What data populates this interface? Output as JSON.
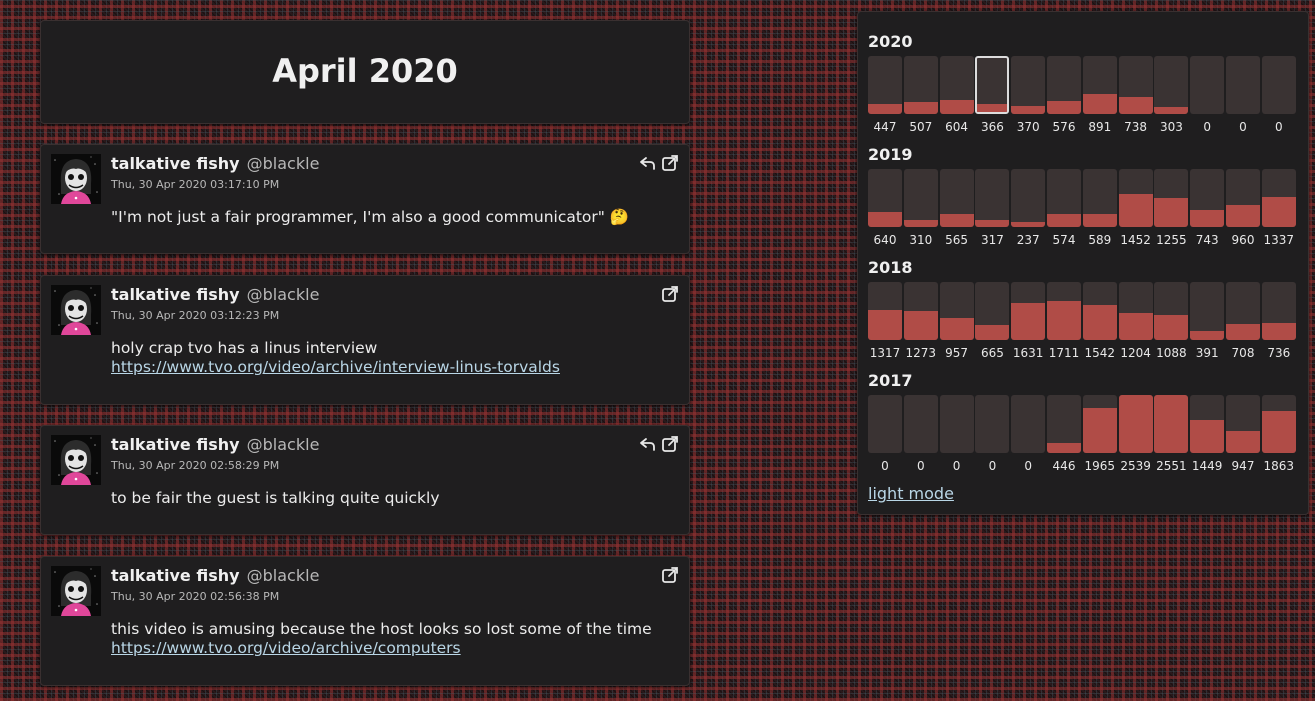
{
  "page": {
    "title": "April 2020"
  },
  "posts": [
    {
      "name": "talkative fishy",
      "handle": "@blackle",
      "date": "Thu, 30 Apr 2020 03:17:10 PM",
      "lines": [
        "\"I'm not just a fair programmer, I'm also a good communicator\" 🤔"
      ],
      "link": "",
      "is_reply": true
    },
    {
      "name": "talkative fishy",
      "handle": "@blackle",
      "date": "Thu, 30 Apr 2020 03:12:23 PM",
      "lines": [
        "holy crap tvo has a linus interview"
      ],
      "link": "https://www.tvo.org/video/archive/interview-linus-torvalds",
      "is_reply": false
    },
    {
      "name": "talkative fishy",
      "handle": "@blackle",
      "date": "Thu, 30 Apr 2020 02:58:29 PM",
      "lines": [
        "to be fair the guest is talking quite quickly"
      ],
      "link": "",
      "is_reply": true
    },
    {
      "name": "talkative fishy",
      "handle": "@blackle",
      "date": "Thu, 30 Apr 2020 02:56:38 PM",
      "lines": [
        "this video is amusing because the host looks so lost some of the time"
      ],
      "link": "https://www.tvo.org/video/archive/computers",
      "is_reply": false
    }
  ],
  "icons": {
    "reply": "reply-icon",
    "open": "open-external-icon",
    "avatar": "avatar-image"
  },
  "colors": {
    "bar_fill": "#b04c47",
    "bar_track": "#3a3333",
    "link": "#b9d6e6"
  },
  "calendar": {
    "years": [
      {
        "year": "2020",
        "counts": [
          447,
          507,
          604,
          366,
          370,
          576,
          891,
          738,
          303,
          0,
          0,
          0
        ],
        "selected_month_index": 3
      },
      {
        "year": "2019",
        "counts": [
          640,
          310,
          565,
          317,
          237,
          574,
          589,
          1452,
          1255,
          743,
          960,
          1337
        ]
      },
      {
        "year": "2018",
        "counts": [
          1317,
          1273,
          957,
          665,
          1631,
          1711,
          1542,
          1204,
          1088,
          391,
          708,
          736
        ]
      },
      {
        "year": "2017",
        "counts": [
          0,
          0,
          0,
          0,
          0,
          446,
          1965,
          2539,
          2551,
          1449,
          947,
          1863
        ]
      }
    ],
    "max_count": 2551,
    "mode_link": "light mode"
  }
}
